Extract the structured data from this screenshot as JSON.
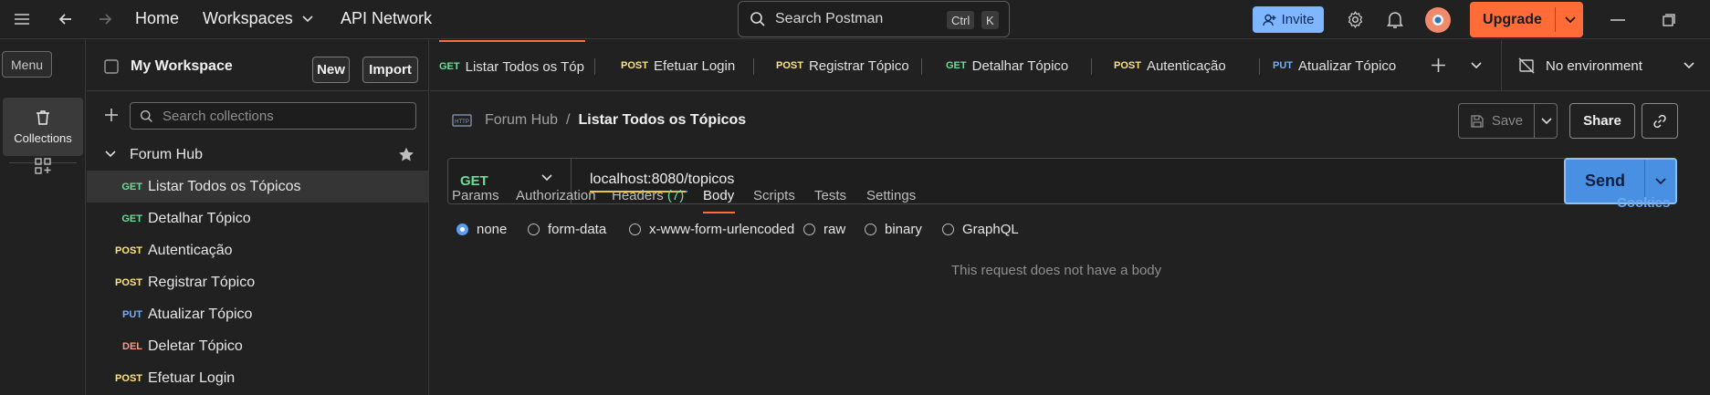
{
  "topbar": {
    "home": "Home",
    "workspaces": "Workspaces",
    "api_network": "API Network",
    "search_placeholder": "Search Postman",
    "kbd_ctrl": "Ctrl",
    "kbd_k": "K",
    "invite": "Invite",
    "upgrade": "Upgrade"
  },
  "rail": {
    "menu_tooltip": "Menu",
    "collections": "Collections"
  },
  "sidebar": {
    "workspace_title": "My Workspace",
    "new_label": "New",
    "import_label": "Import",
    "search_placeholder": "Search collections",
    "collection_name": "Forum Hub",
    "items": [
      {
        "method": "GET",
        "name": "Listar Todos os Tópicos",
        "selected": true
      },
      {
        "method": "GET",
        "name": "Detalhar Tópico"
      },
      {
        "method": "POST",
        "name": "Autenticação"
      },
      {
        "method": "POST",
        "name": "Registrar Tópico"
      },
      {
        "method": "PUT",
        "name": "Atualizar Tópico"
      },
      {
        "method": "DEL",
        "name": "Deletar Tópico"
      },
      {
        "method": "POST",
        "name": "Efetuar Login"
      }
    ]
  },
  "tabs": [
    {
      "method": "GET",
      "name": "Listar Todos os Tópicos",
      "active": true
    },
    {
      "method": "POST",
      "name": "Efetuar Login"
    },
    {
      "method": "POST",
      "name": "Registrar Tópico"
    },
    {
      "method": "GET",
      "name": "Detalhar Tópico"
    },
    {
      "method": "POST",
      "name": "Autenticação"
    },
    {
      "method": "PUT",
      "name": "Atualizar Tópico"
    }
  ],
  "environment": "No environment",
  "request": {
    "breadcrumb_parent": "Forum Hub",
    "breadcrumb_sep": "/",
    "breadcrumb_current": "Listar Todos os Tópicos",
    "save_label": "Save",
    "share_label": "Share",
    "method": "GET",
    "url": "localhost:8080/topicos",
    "send_label": "Send",
    "tabs": {
      "params": "Params",
      "authorization": "Authorization",
      "headers": "Headers",
      "headers_count": "(7)",
      "body": "Body",
      "scripts": "Scripts",
      "tests": "Tests",
      "settings": "Settings"
    },
    "cookies": "Cookies",
    "body_options": [
      "none",
      "form-data",
      "x-www-form-urlencoded",
      "raw",
      "binary",
      "GraphQL"
    ],
    "body_selected": "none",
    "empty_message": "This request does not have a body"
  },
  "colors": {
    "accent": "#ff6c37",
    "get": "#6bdd9a",
    "post": "#ffe47e",
    "put": "#74aef6",
    "delete": "#f79a8e",
    "send": "#4a90e2"
  }
}
